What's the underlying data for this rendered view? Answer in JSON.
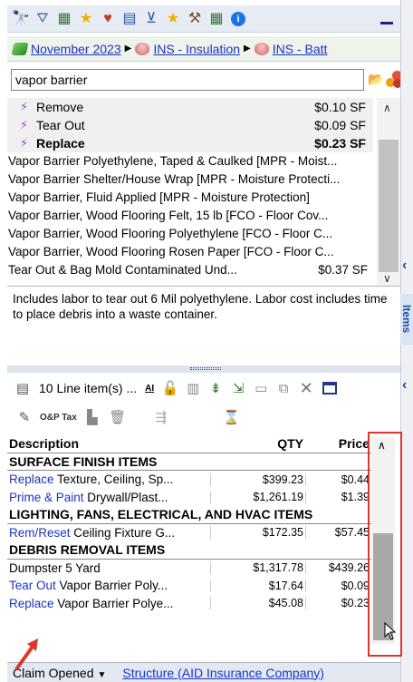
{
  "toolbar": {
    "icons": [
      "binoculars-icon",
      "filter-icon",
      "image-icon",
      "star-icon",
      "heart-star-icon",
      "grid-icon",
      "cart-icon",
      "star-icon",
      "hammer-icon",
      "calendar-icon",
      "info-icon"
    ]
  },
  "breadcrumb": {
    "items": [
      "November 2023",
      "INS - Insulation",
      "INS - Batt"
    ]
  },
  "search": {
    "value": "vapor barrier"
  },
  "operations": [
    {
      "label": "Remove",
      "price": "$0.10 SF",
      "bold": false
    },
    {
      "label": "Tear Out",
      "price": "$0.09 SF",
      "bold": false
    },
    {
      "label": "Replace",
      "price": "$0.23 SF",
      "bold": true
    }
  ],
  "search_results": [
    "Vapor Barrier Polyethylene, Taped & Caulked [MPR - Moist...",
    "Vapor Barrier Shelter/House Wrap [MPR - Moisture Protecti...",
    "Vapor Barrier, Fluid Applied [MPR - Moisture Protection]",
    "Vapor Barrier, Wood Flooring Felt, 15 lb [FCO - Floor Cov...",
    "Vapor Barrier, Wood Flooring Polyethylene [FCO - Floor C...",
    "Vapor Barrier, Wood Flooring Rosen Paper [FCO - Floor C...",
    "Tear Out & Bag Mold Contaminated Und..."
  ],
  "search_results_partial_price": "$0.37 SF",
  "description": "Includes labor to tear out 6 Mil polyethylene.  Labor cost includes time to place debris into a waste container.",
  "side_tab": {
    "label": "Items"
  },
  "line_items_toolbar": {
    "count_label": "10 Line item(s) ...",
    "ai_label": "AI"
  },
  "line_items_toolbar2": {
    "op_tax_label": "O&P Tax"
  },
  "table": {
    "headers": {
      "description": "Description",
      "qty": "QTY",
      "price": "Price"
    },
    "rows": [
      {
        "type": "section",
        "description": "SURFACE FINISH ITEMS"
      },
      {
        "type": "item",
        "op": "Replace",
        "rest": " Texture, Ceiling, Sp...",
        "qty": "$399.23",
        "price": "$0.44"
      },
      {
        "type": "item",
        "op": "Prime & Paint",
        "rest": " Drywall/Plast...",
        "qty": "$1,261.19",
        "price": "$1.39"
      },
      {
        "type": "section",
        "description": "LIGHTING, FANS, ELECTRICAL, AND HVAC ITEMS"
      },
      {
        "type": "item",
        "op": "Rem/Reset",
        "rest": " Ceiling Fixture G...",
        "qty": "$172.35",
        "price": "$57.45"
      },
      {
        "type": "section",
        "description": "DEBRIS REMOVAL ITEMS"
      },
      {
        "type": "item",
        "op": "",
        "rest": "Dumpster 5 Yard",
        "qty": "$1,317.78",
        "price": "$439.26"
      },
      {
        "type": "item",
        "op": "Tear Out",
        "rest": " Vapor Barrier Poly...",
        "qty": "$17.64",
        "price": "$0.09"
      },
      {
        "type": "item",
        "op": "Replace",
        "rest": " Vapor Barrier Polye...",
        "qty": "$45.08",
        "price": "$0.23"
      }
    ]
  },
  "status_bar": {
    "claim_status": "Claim Opened",
    "structure": "Structure (AID Insurance Company)"
  },
  "colors": {
    "link": "#1b33c4",
    "highlight": "#e0342f"
  }
}
